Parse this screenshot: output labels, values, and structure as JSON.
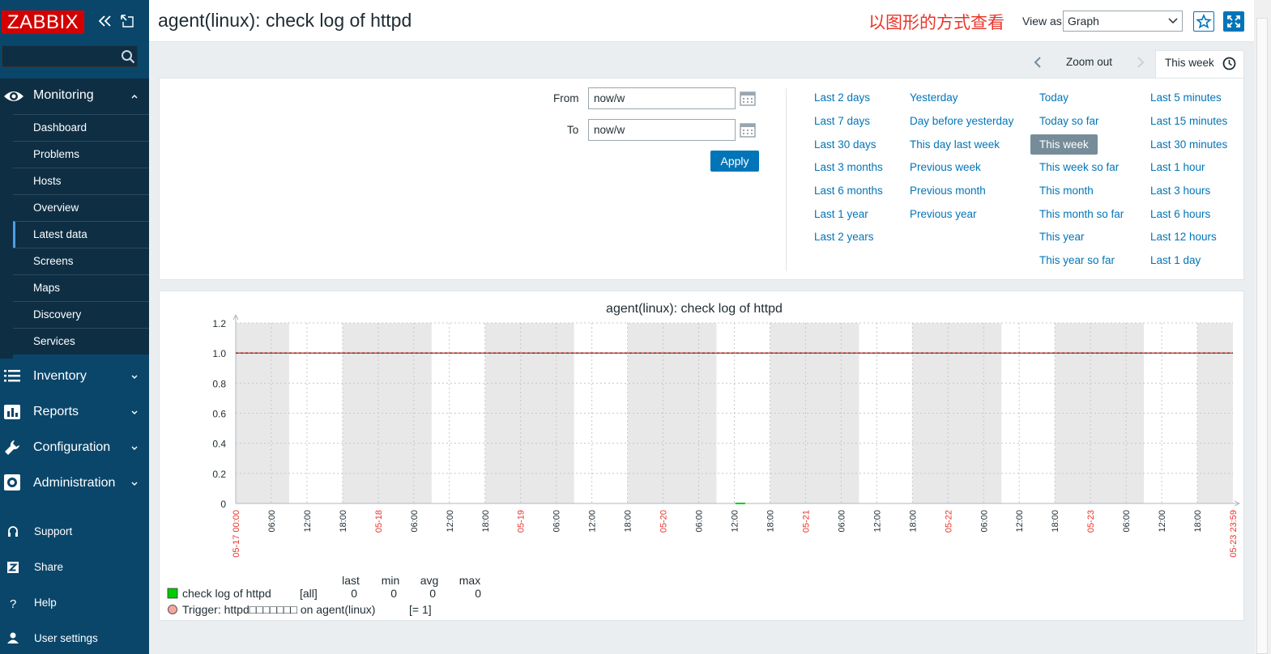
{
  "sidebar": {
    "logo": "ZABBIX",
    "search_placeholder": "",
    "monitoring": {
      "label": "Monitoring",
      "items": [
        {
          "label": "Dashboard"
        },
        {
          "label": "Problems"
        },
        {
          "label": "Hosts"
        },
        {
          "label": "Overview"
        },
        {
          "label": "Latest data",
          "selected": true
        },
        {
          "label": "Screens"
        },
        {
          "label": "Maps"
        },
        {
          "label": "Discovery"
        },
        {
          "label": "Services"
        }
      ]
    },
    "sections": [
      {
        "label": "Inventory",
        "icon": "list-icon"
      },
      {
        "label": "Reports",
        "icon": "bar-chart-icon"
      },
      {
        "label": "Configuration",
        "icon": "wrench-icon"
      },
      {
        "label": "Administration",
        "icon": "gear-icon"
      }
    ],
    "bottom": [
      {
        "label": "Support",
        "icon": "headset-icon"
      },
      {
        "label": "Share",
        "icon": "share-z-icon"
      },
      {
        "label": "Help",
        "icon": "question-icon"
      },
      {
        "label": "User settings",
        "icon": "user-icon"
      }
    ]
  },
  "header": {
    "title": "agent(linux): check log of httpd",
    "annotation": "以图形的方式查看",
    "view_as_label": "View as",
    "view_as_value": "Graph"
  },
  "timebar": {
    "zoom_out": "Zoom out",
    "active_tab": "This week"
  },
  "filter": {
    "from_label": "From",
    "from_value": "now/w",
    "to_label": "To",
    "to_value": "now/w",
    "apply_label": "Apply",
    "quick_ranges": [
      [
        "Last 2 days",
        "Last 7 days",
        "Last 30 days",
        "Last 3 months",
        "Last 6 months",
        "Last 1 year",
        "Last 2 years"
      ],
      [
        "Yesterday",
        "Day before yesterday",
        "This day last week",
        "Previous week",
        "Previous month",
        "Previous year"
      ],
      [
        "Today",
        "Today so far",
        "This week",
        "This week so far",
        "This month",
        "This month so far",
        "This year",
        "This year so far"
      ],
      [
        "Last 5 minutes",
        "Last 15 minutes",
        "Last 30 minutes",
        "Last 1 hour",
        "Last 3 hours",
        "Last 6 hours",
        "Last 12 hours",
        "Last 1 day"
      ]
    ],
    "selected_range": "This week"
  },
  "chart_data": {
    "type": "line",
    "title": "agent(linux): check log of httpd",
    "ylim": [
      0,
      1.2
    ],
    "y_ticks": [
      "1.2",
      "1.0",
      "0.8",
      "0.6",
      "0.4",
      "0.2",
      "0"
    ],
    "x_ticks": [
      "05-17 00:00",
      "06:00",
      "12:00",
      "18:00",
      "05-18",
      "06:00",
      "12:00",
      "18:00",
      "05-19",
      "06:00",
      "12:00",
      "18:00",
      "05-20",
      "06:00",
      "12:00",
      "18:00",
      "05-21",
      "06:00",
      "12:00",
      "18:00",
      "05-22",
      "06:00",
      "12:00",
      "18:00",
      "05-23",
      "06:00",
      "12:00",
      "18:00",
      "05-23 23:59"
    ],
    "date_tick_color": "#e8352a",
    "grid": true,
    "series": [
      {
        "name": "check log of httpd",
        "color": "#00cc00",
        "values": [
          0
        ],
        "x": [
          "05-20 13:00"
        ],
        "legend_scope": "[all]",
        "last": "0",
        "min": "0",
        "avg": "0",
        "max": "0"
      }
    ],
    "trigger": {
      "label": "Trigger: httpd□□□□□□□ on agent(linux)",
      "condition": "[= 1]",
      "value": 1,
      "color": "#e8352a"
    },
    "legend_headers": [
      "last",
      "min",
      "avg",
      "max"
    ]
  }
}
